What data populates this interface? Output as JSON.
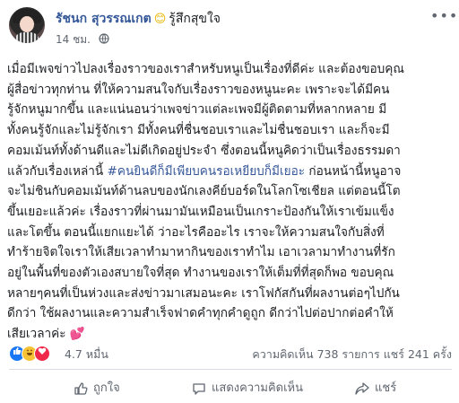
{
  "post": {
    "author": "รัชนก สุวรรณเกต",
    "feeling_emoji": "😊",
    "feeling_text": "รู้สึกสุขใจ",
    "time": "14 ชม.",
    "body_lines": [
      "เมื่อมีเพจข่าวไปลงเรื่องราวของเราสำหรับหนูเป็นเรื่องที่ดีค่ะ และต้องขอบคุณ",
      "ผู้สื่อข่าวทุกท่าน ที่ให้ความสนใจกับเรื่องราวของหนูนะคะ เพราะจะได้มีคน",
      "รู้จักหนูมากขึ้น และแน่นอนว่าเพจข่าวแต่ละเพจมีผู้ติดตามที่หลากหลาย มี",
      "ทั้งคนรู้จักและไม่รู้จักเรา มีทั้งคนที่ชื่นชอบเราและไม่ชื่นชอบเรา และก็จะมี",
      "คอมเม้นท์ทั้งด้านดีและไม่ดีเกิดอยู่ประจำ ซึ่งตอนนี้หนูคิดว่าเป็นเรื่องธรรมดา",
      "แล้วกับเรื่องเหล่านี้ ",
      " ก่อนหน้านี้หนูอาจ",
      "จะไม่ชินกับคอมเม้นท์ด้านลบของนักเลงคีย์บอร์ดในโลกโซเชียล แต่ตอนนี้โต",
      "ขึ้นเยอะแล้วค่ะ เรื่องราวที่ผ่านมามันเหมือนเป็นเกราะป้องกันให้เราเข้มแข็ง",
      "และโตขึ้น ตอนนี้แยกแยะได้ ว่าอะไรคืออะไร เราจะให้ความสนใจกับสิ่งที่",
      "ทำร้ายจิตใจเราให้เสียเวลาทำมาหากินของเราทำไม เอาเวลามาทำงานที่รัก",
      "อยู่ในพื้นที่ของตัวเองสบายใจที่สุด ทำงานของเราให้เต็มที่ที่สุดก็พอ ขอบคุณ",
      "หลายๆคนที่เป็นห่วงและส่งข่าวมาเสมอนะคะ เราโฟกัสกันที่ผลงานต่อๆไปกัน",
      "ดีกว่า ใช้ผลงานและความสำเร็จฟาดคำทุกคำดูถูก ดีกว่าไปต่อปากต่อคำให้",
      "เสียเวลาค่ะ "
    ],
    "hashtag": "#คนยินดีก็มีเพียบคนรอเหยียบก็มีเยอะ",
    "end_emoji": "💕",
    "reactions_count": "4.7 หมื่น",
    "comments_text": "ความคิดเห็น 738 รายการ",
    "shares_text": "แชร์ 241 ครั้ง"
  },
  "actions": {
    "like": "ถูกใจ",
    "comment": "แสดงความคิดเห็น",
    "share": "แชร์"
  },
  "icons": {
    "more": "more-dots-icon",
    "privacy": "globe-icon",
    "reactions": [
      "like-reaction-icon",
      "haha-reaction-icon",
      "love-reaction-icon"
    ]
  },
  "colors": {
    "name": "#365899",
    "secondary_text": "#606770",
    "like_blue": "#1877f2",
    "love_red": "#f02849"
  }
}
